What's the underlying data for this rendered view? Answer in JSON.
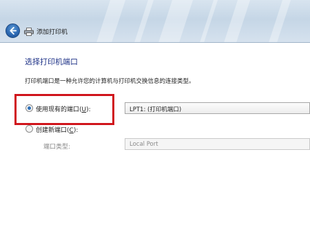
{
  "window": {
    "title": "添加打印机",
    "back_icon": "back-arrow-icon",
    "printer_icon": "printer-icon"
  },
  "page": {
    "heading": "选择打印机端口",
    "description": "打印机端口是一种允许您的计算机与打印机交换信息的连接类型。"
  },
  "options": {
    "use_existing": {
      "label_prefix": "使用现有的端口(",
      "access_key": "U",
      "label_suffix": "):",
      "selected": true,
      "value": "LPT1: (打印机端口)"
    },
    "create_new": {
      "label_prefix": "创建新端口(",
      "access_key": "C",
      "label_suffix": "):",
      "selected": false,
      "type_label": "端口类型:",
      "type_value": "Local Port"
    }
  },
  "colors": {
    "heading": "#1e3287",
    "highlight": "#d0141b",
    "radio_dot": "#2c6fb8"
  }
}
